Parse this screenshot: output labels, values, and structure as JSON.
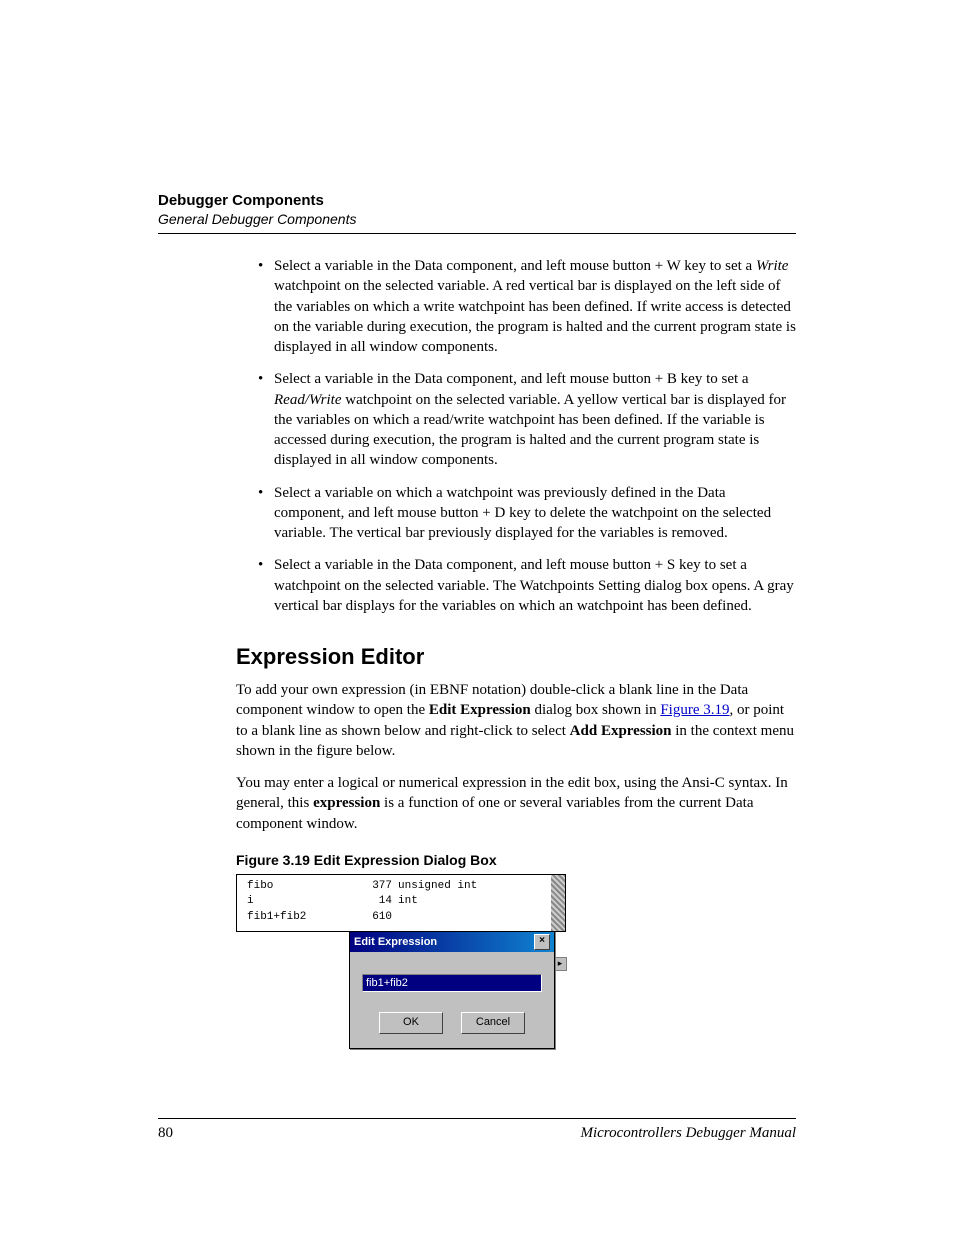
{
  "header": {
    "title": "Debugger Components",
    "subtitle": "General Debugger Components"
  },
  "bullets": [
    {
      "pre": "Select a variable in the Data component, and left mouse button + W key to set a ",
      "em": "Write",
      "post": " watchpoint on the selected variable. A red vertical bar is displayed on the left side of the variables on which a write watchpoint has been defined. If write access is detected on the variable during execution, the program is halted and the current program state is displayed in all window components."
    },
    {
      "pre": "Select a variable in the Data component, and left mouse button + B key to set a ",
      "em": "Read/Write",
      "post": " watchpoint on the selected variable. A yellow vertical bar is displayed for the variables on which a read/write watchpoint has been defined. If the variable is accessed during execution, the program is halted and the current program state is displayed in all window components."
    },
    {
      "pre": "Select a variable on which a watchpoint was previously defined in the Data component, and left mouse button + D key to delete the watchpoint on the selected variable. The vertical bar previously displayed for the variables is removed.",
      "em": "",
      "post": ""
    },
    {
      "pre": "Select a variable in the Data component, and left mouse button + S key to set a watchpoint on the selected variable. The Watchpoints Setting dialog box opens. A gray vertical bar displays for the variables on which an watchpoint has been defined.",
      "em": "",
      "post": ""
    }
  ],
  "section": {
    "heading": "Expression Editor",
    "para1_pre": "To add your own expression (in EBNF notation) double-click a blank line in the Data component window to open the ",
    "para1_b1": "Edit Expression",
    "para1_mid": " dialog box shown in ",
    "para1_link": "Figure 3.19",
    "para1_mid2": ", or point to a blank line as shown below and right-click to select ",
    "para1_b2": "Add Expression",
    "para1_post": " in the context menu shown in the figure below.",
    "para2_pre": "You may enter a logical or numerical expression in the edit box, using the Ansi-C syntax. In general, this ",
    "para2_b": "expression",
    "para2_post": " is a function of one or several variables from the current Data component window."
  },
  "figure": {
    "caption": "Figure 3.19  Edit Expression Dialog Box",
    "rows": [
      {
        "name": "fibo",
        "val": "377",
        "type": "unsigned int"
      },
      {
        "name": "i",
        "val": "14",
        "type": "int"
      },
      {
        "name": "fib1+fib2",
        "val": "610",
        "type": ""
      }
    ],
    "dialog_title": "Edit Expression",
    "dialog_input": "fib1+fib2",
    "ok": "OK",
    "cancel": "Cancel"
  },
  "footer": {
    "page": "80",
    "manual": "Microcontrollers Debugger Manual"
  }
}
